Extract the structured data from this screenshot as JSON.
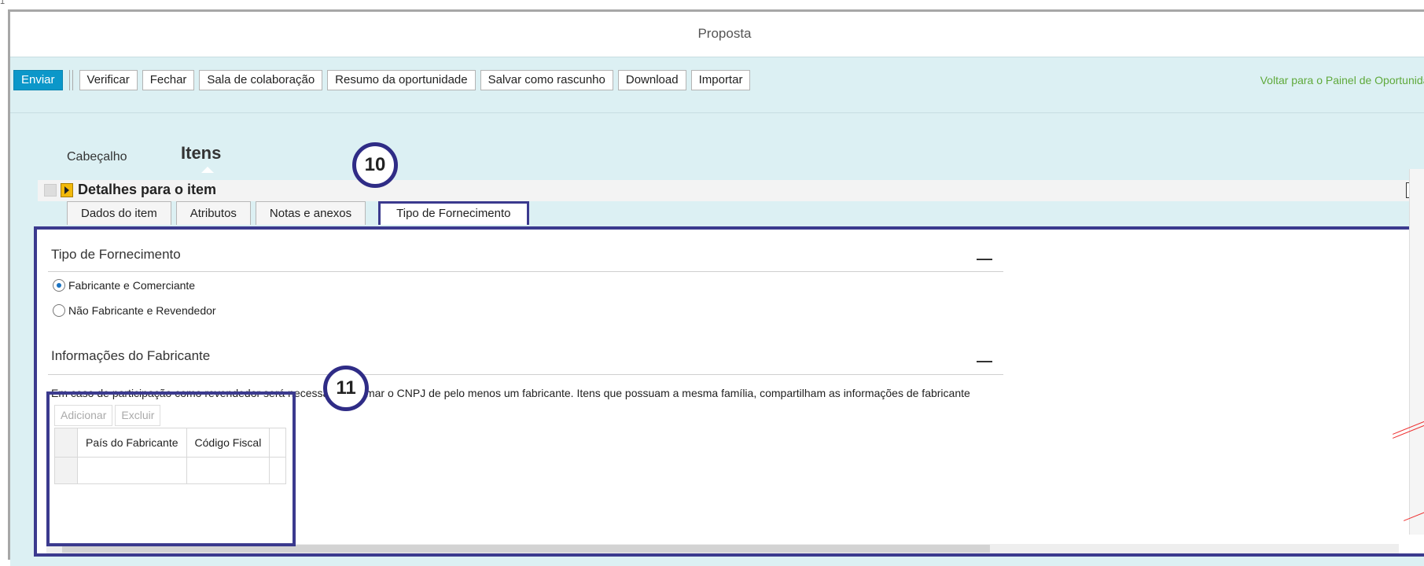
{
  "window": {
    "title": "Proposta"
  },
  "toolbar": {
    "buttons": [
      "Enviar",
      "Verificar",
      "Fechar",
      "Sala de colaboração",
      "Resumo da oportunidade",
      "Salvar como rascunho",
      "Download",
      "Importar"
    ],
    "back_link": "Voltar para o Painel de Oportunidades"
  },
  "nav": {
    "tabs": [
      "Cabeçalho",
      "Itens"
    ],
    "active": "Itens"
  },
  "details": {
    "title": "Detalhes para o item",
    "tabs": [
      "Dados do item",
      "Atributos",
      "Notas e anexos",
      "Tipo de Fornecimento"
    ],
    "active_tab": "Tipo de Fornecimento"
  },
  "supply": {
    "section_title": "Tipo de Fornecimento",
    "options": [
      {
        "label": "Fabricante e Comerciante",
        "checked": true
      },
      {
        "label": "Não Fabricante e Revendedor",
        "checked": false
      }
    ]
  },
  "manufacturer": {
    "section_title": "Informações do Fabricante",
    "info": "Em caso de participação como revendedor será necessário informar o CNPJ de pelo menos um fabricante. Itens que possuam a mesma família, compartilham as informações de fabricante",
    "buttons": [
      "Adicionar",
      "Excluir"
    ],
    "columns": [
      "País do Fabricante",
      "Código Fiscal"
    ]
  },
  "callouts": [
    "10",
    "11"
  ],
  "colors": {
    "accent": "#0b97c9",
    "callout_border": "#2f2c86",
    "link": "#5fa93b",
    "toolbar_bg": "#dcf0f3"
  }
}
